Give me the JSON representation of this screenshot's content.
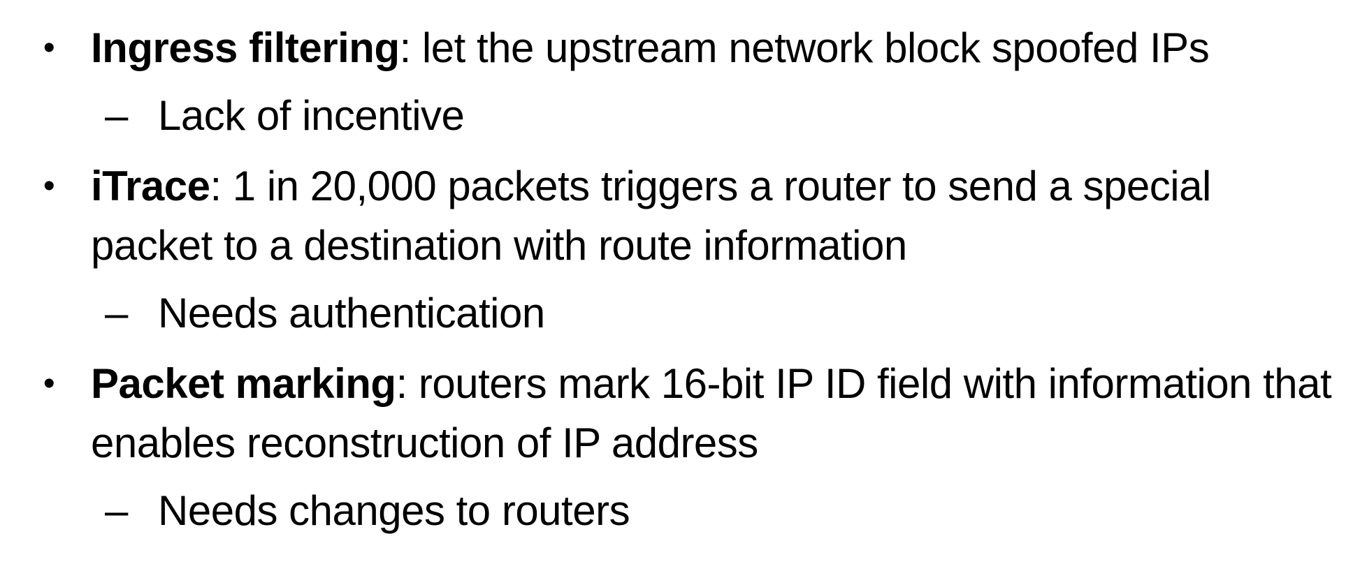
{
  "bullets": [
    {
      "term": "Ingress filtering",
      "text": ": let the upstream network block spoofed IPs",
      "sub": "Lack of incentive"
    },
    {
      "term": "iTrace",
      "text": ": 1 in 20,000 packets triggers a router to send a special packet to a destination with route information",
      "sub": "Needs authentication"
    },
    {
      "term": "Packet marking",
      "text": ": routers mark 16-bit IP ID field with information that enables reconstruction of IP address",
      "sub": "Needs changes to routers"
    }
  ],
  "bullet_glyph": "•",
  "dash_glyph": "–"
}
